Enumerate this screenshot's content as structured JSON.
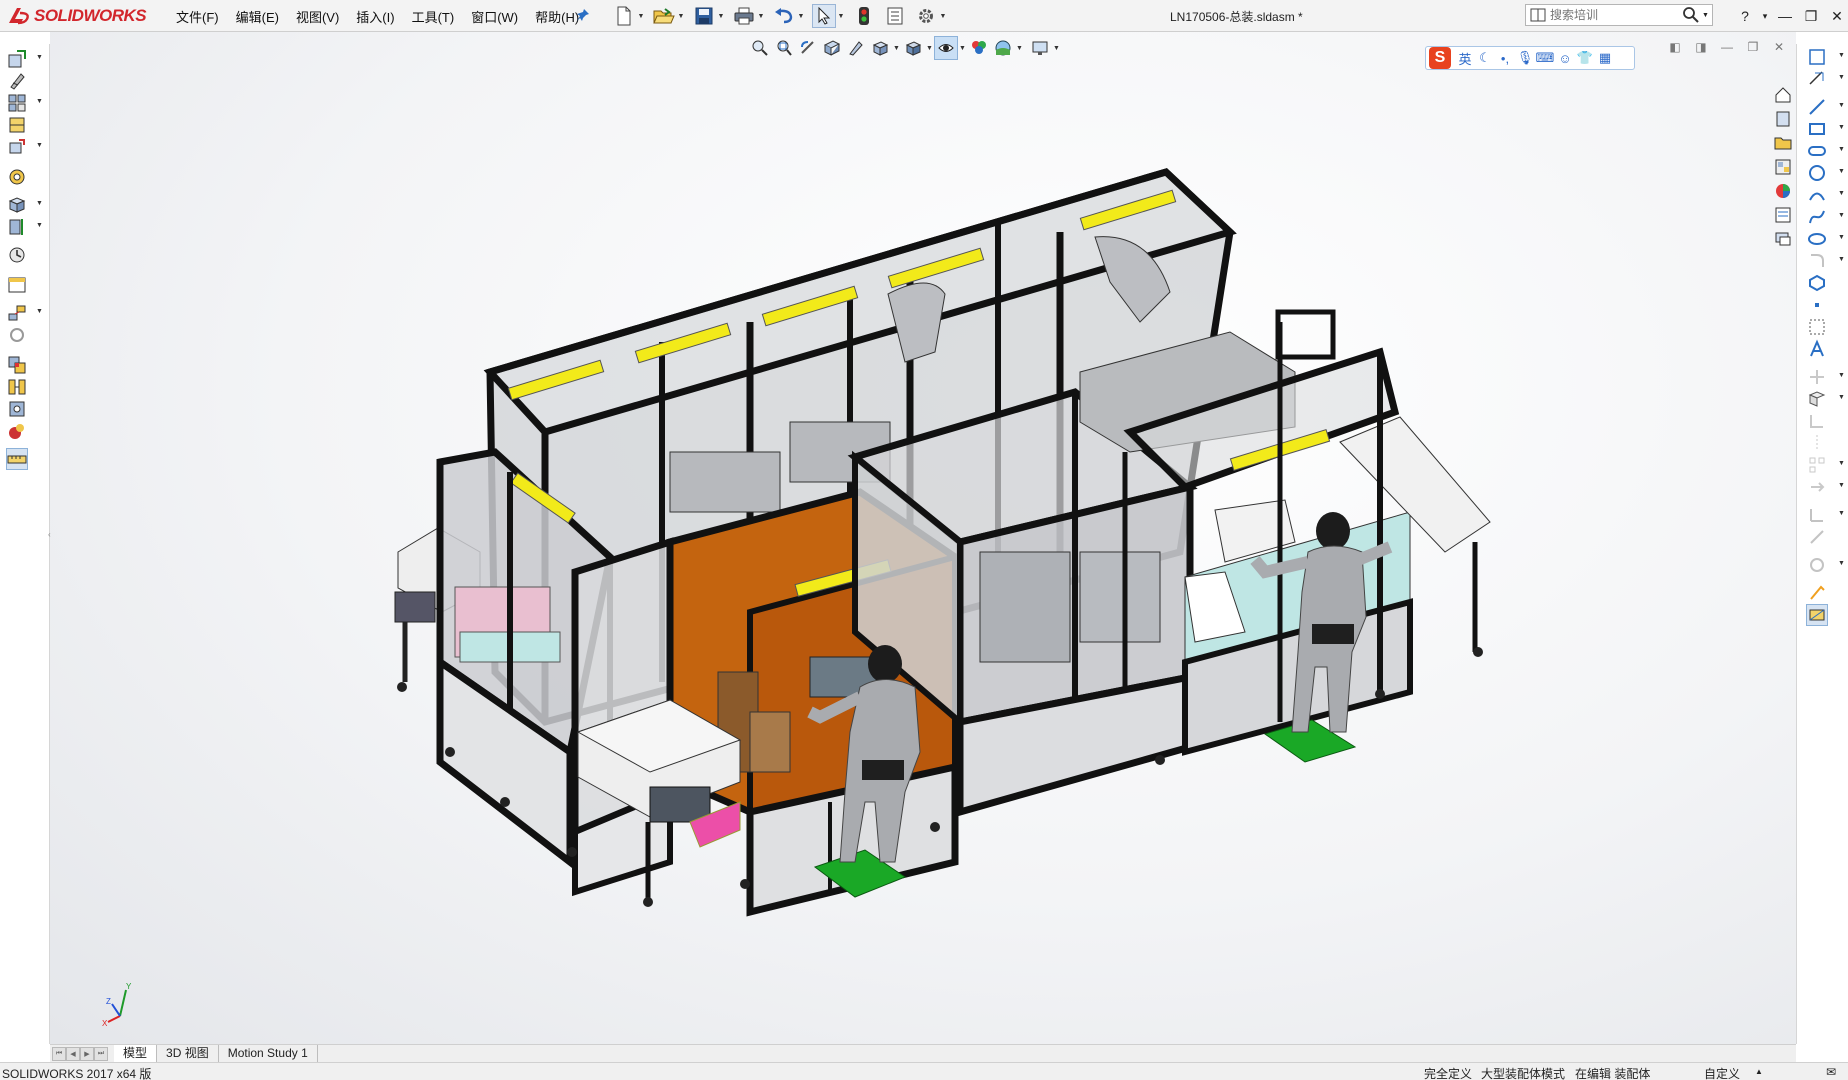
{
  "app": {
    "brand": "SOLIDWORKS",
    "document_title": "LN170506-总装.sldasm *"
  },
  "menu": [
    "文件(F)",
    "编辑(E)",
    "视图(V)",
    "插入(I)",
    "工具(T)",
    "窗口(W)",
    "帮助(H)"
  ],
  "quick_access": [
    {
      "icon": "new-document-icon",
      "dropdown": true
    },
    {
      "icon": "open-folder-icon",
      "dropdown": true
    },
    {
      "icon": "save-icon",
      "dropdown": true
    },
    {
      "icon": "print-icon",
      "dropdown": true
    },
    {
      "icon": "undo-icon",
      "dropdown": true
    },
    {
      "icon": "select-arrow-icon",
      "dropdown": true
    },
    {
      "icon": "rebuild-traffic-light-icon",
      "dropdown": false
    },
    {
      "icon": "file-properties-icon",
      "dropdown": false
    },
    {
      "icon": "options-gear-icon",
      "dropdown": true
    }
  ],
  "search": {
    "placeholder": "搜索培训"
  },
  "window_controls": [
    "?",
    "▾",
    "—",
    "❐",
    "✕"
  ],
  "heads_up_toolbar": [
    "zoom-to-fit-icon",
    "zoom-to-area-icon",
    "previous-view-icon",
    "section-view-icon",
    "dynamic-annotation-icon",
    "view-orientation-icon",
    "display-style-icon",
    "hide-show-items-icon",
    "edit-appearance-icon",
    "apply-scene-icon",
    "view-settings-icon"
  ],
  "ime": {
    "logo": "S",
    "mode": "英"
  },
  "tabs": [
    "模型",
    "3D 视图",
    "Motion Study 1"
  ],
  "active_tab": "模型",
  "status": {
    "version": "SOLIDWORKS 2017 x64 版",
    "definition": "完全定义",
    "mode": "大型装配体模式",
    "editing": "在编辑 装配体",
    "units": "自定义"
  },
  "colors": {
    "brand_red": "#d2262c",
    "frame_black": "#1a1a1a",
    "guard_yellow": "#f2ea1a",
    "booth_orange": "#c4640f",
    "floor_mat_green": "#1aa826",
    "conveyor_pink": "#ec4fa8",
    "base_panel_cyan": "#bfe6e4"
  },
  "triad": {
    "x": "X",
    "y": "Y",
    "z": "Z"
  }
}
